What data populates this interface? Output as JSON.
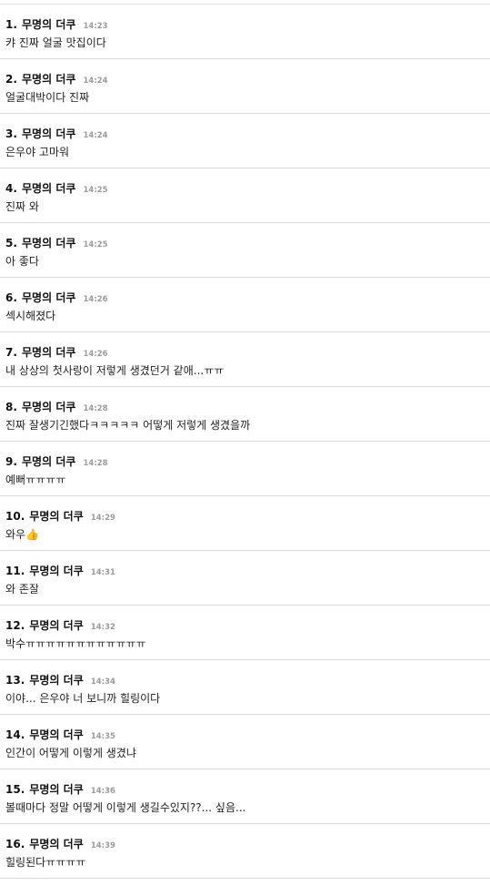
{
  "comments": [
    {
      "num": "1.",
      "author": "무명의 더쿠",
      "time": "14:23",
      "text": "캬 진짜 얼굴 맛집이다"
    },
    {
      "num": "2.",
      "author": "무명의 더쿠",
      "time": "14:24",
      "text": "얼굴대박이다 진짜"
    },
    {
      "num": "3.",
      "author": "무명의 더쿠",
      "time": "14:24",
      "text": "은우야 고마워"
    },
    {
      "num": "4.",
      "author": "무명의 더쿠",
      "time": "14:25",
      "text": "진짜 와"
    },
    {
      "num": "5.",
      "author": "무명의 더쿠",
      "time": "14:25",
      "text": "아 좋다"
    },
    {
      "num": "6.",
      "author": "무명의 더쿠",
      "time": "14:26",
      "text": "섹시해졌다"
    },
    {
      "num": "7.",
      "author": "무명의 더쿠",
      "time": "14:26",
      "text": "내 상상의 첫사랑이 저렇게 생겼던거 같애...ㅠㅠ"
    },
    {
      "num": "8.",
      "author": "무명의 더쿠",
      "time": "14:28",
      "text": "진짜 잘생기긴했다ㅋㅋㅋㅋㅋ 어떻게 저렇게 생겼을까"
    },
    {
      "num": "9.",
      "author": "무명의 더쿠",
      "time": "14:28",
      "text": "예뻐ㅠㅠㅠㅠ"
    },
    {
      "num": "10.",
      "author": "무명의 더쿠",
      "time": "14:29",
      "text": "와우👍"
    },
    {
      "num": "11.",
      "author": "무명의 더쿠",
      "time": "14:31",
      "text": "와 존잘"
    },
    {
      "num": "12.",
      "author": "무명의 더쿠",
      "time": "14:32",
      "text": "박수ㅠㅠㅠㅠㅠㅠㅠㅠㅠㅠㅠㅠ"
    },
    {
      "num": "13.",
      "author": "무명의 더쿠",
      "time": "14:34",
      "text": "이야... 은우야 너 보니까 힐링이다"
    },
    {
      "num": "14.",
      "author": "무명의 더쿠",
      "time": "14:35",
      "text": "인간이 어떻게 이렇게 생겼냐"
    },
    {
      "num": "15.",
      "author": "무명의 더쿠",
      "time": "14:36",
      "text": "볼때마다 정말 어떻게 이렇게 생길수있지??... 싶음..."
    },
    {
      "num": "16.",
      "author": "무명의 더쿠",
      "time": "14:39",
      "text": "힐링된다ㅠㅠㅠㅠ"
    }
  ]
}
